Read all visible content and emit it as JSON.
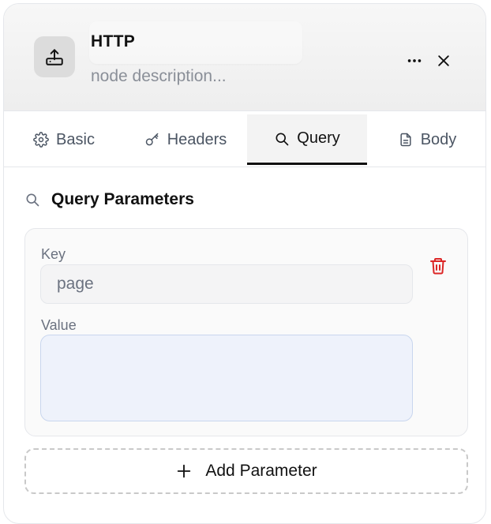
{
  "node": {
    "title": "HTTP",
    "description": "node description...",
    "icon": "upload-tray-icon"
  },
  "tabs": [
    {
      "label": "Basic",
      "icon": "gear-icon",
      "active": false
    },
    {
      "label": "Headers",
      "icon": "key-icon",
      "active": false
    },
    {
      "label": "Query",
      "icon": "search-icon",
      "active": true
    },
    {
      "label": "Body",
      "icon": "document-icon",
      "active": false
    }
  ],
  "query_section": {
    "title": "Query Parameters",
    "params": [
      {
        "key_label": "Key",
        "key_value": "page",
        "value_label": "Value",
        "value": ""
      }
    ],
    "add_button_label": "Add Parameter"
  },
  "colors": {
    "delete": "#dc2626",
    "value_bg": "#eef2fb",
    "active_tab_underline": "#111111"
  }
}
